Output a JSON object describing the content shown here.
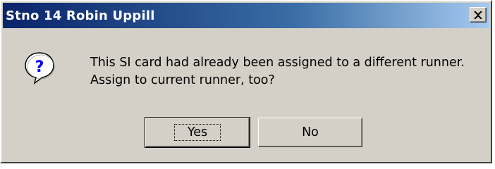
{
  "window": {
    "title": "Stno 14  Robin Uppill",
    "close_icon": "close-x-icon"
  },
  "message": {
    "icon": "question-mark-icon",
    "line1": "This SI card had already been assigned to a different runner.",
    "line2": "Assign to current runner, too?"
  },
  "buttons": {
    "yes_label": "Yes",
    "no_label": "No",
    "default": "yes"
  },
  "colors": {
    "titlebar_start": "#0a246a",
    "titlebar_end": "#a6caf0",
    "dialog_face": "#d4d0c8"
  }
}
